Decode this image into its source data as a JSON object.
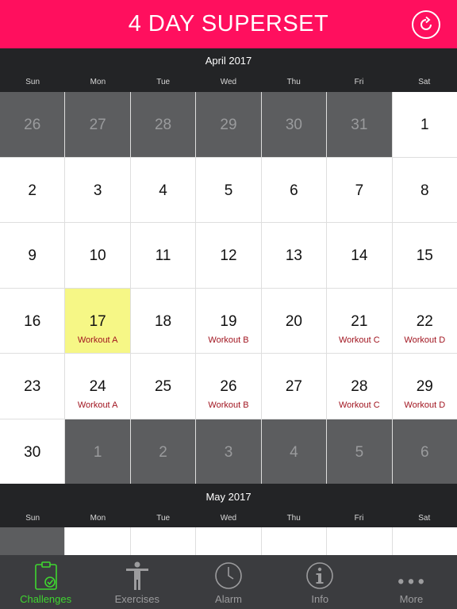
{
  "header": {
    "title": "4 DAY SUPERSET"
  },
  "weekday_labels": [
    "Sun",
    "Mon",
    "Tue",
    "Wed",
    "Thu",
    "Fri",
    "Sat"
  ],
  "months": [
    {
      "title": "April 2017",
      "weeks": [
        [
          {
            "day": "26",
            "out": true
          },
          {
            "day": "27",
            "out": true
          },
          {
            "day": "28",
            "out": true
          },
          {
            "day": "29",
            "out": true
          },
          {
            "day": "30",
            "out": true
          },
          {
            "day": "31",
            "out": true
          },
          {
            "day": "1"
          }
        ],
        [
          {
            "day": "2"
          },
          {
            "day": "3"
          },
          {
            "day": "4"
          },
          {
            "day": "5"
          },
          {
            "day": "6"
          },
          {
            "day": "7"
          },
          {
            "day": "8"
          }
        ],
        [
          {
            "day": "9"
          },
          {
            "day": "10"
          },
          {
            "day": "11"
          },
          {
            "day": "12"
          },
          {
            "day": "13"
          },
          {
            "day": "14"
          },
          {
            "day": "15"
          }
        ],
        [
          {
            "day": "16"
          },
          {
            "day": "17",
            "label": "Workout A",
            "today": true
          },
          {
            "day": "18"
          },
          {
            "day": "19",
            "label": "Workout B"
          },
          {
            "day": "20"
          },
          {
            "day": "21",
            "label": "Workout C"
          },
          {
            "day": "22",
            "label": "Workout D"
          }
        ],
        [
          {
            "day": "23"
          },
          {
            "day": "24",
            "label": "Workout A"
          },
          {
            "day": "25"
          },
          {
            "day": "26",
            "label": "Workout B"
          },
          {
            "day": "27"
          },
          {
            "day": "28",
            "label": "Workout C"
          },
          {
            "day": "29",
            "label": "Workout D"
          }
        ],
        [
          {
            "day": "30"
          },
          {
            "day": "1",
            "out": true
          },
          {
            "day": "2",
            "out": true
          },
          {
            "day": "3",
            "out": true
          },
          {
            "day": "4",
            "out": true
          },
          {
            "day": "5",
            "out": true
          },
          {
            "day": "6",
            "out": true
          }
        ]
      ]
    },
    {
      "title": "May 2017"
    }
  ],
  "tabbar": {
    "items": [
      {
        "label": "Challenges",
        "icon": "clipboard-check-icon",
        "active": true
      },
      {
        "label": "Exercises",
        "icon": "person-icon"
      },
      {
        "label": "Alarm",
        "icon": "clock-icon"
      },
      {
        "label": "Info",
        "icon": "info-icon"
      },
      {
        "label": "More",
        "icon": "more-dots-icon"
      }
    ]
  },
  "colors": {
    "header": "#ff0f5e",
    "dark": "#232426",
    "out_cell": "#5c5d5f",
    "today": "#f6f786",
    "workout_label": "#a11520",
    "tab_active": "#3fd630"
  }
}
